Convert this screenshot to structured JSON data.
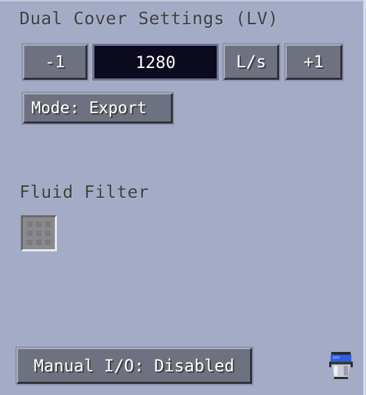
{
  "window": {
    "title": "Dual Cover Settings (LV)"
  },
  "controls": {
    "minus_label": "-1",
    "rate_value": "1280",
    "unit_label": "L/s",
    "plus_label": "+1",
    "mode_label": "Mode: Export"
  },
  "filter": {
    "label": "Fluid Filter"
  },
  "footer": {
    "manual_io_label": "Manual I/O: Disabled",
    "icon": "bucket-icon"
  }
}
